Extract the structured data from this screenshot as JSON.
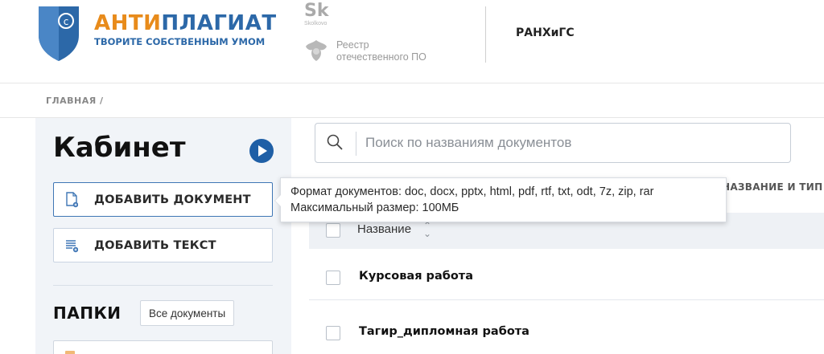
{
  "header": {
    "brand_part1": "АНТИ",
    "brand_part2": "ПЛАГИАТ",
    "tagline": "ТВОРИТЕ СОБСТВЕННЫМ УМОМ",
    "skolkovo_mark": "Sk",
    "skolkovo_small": "Skolkovo",
    "registry_line1": "Реестр",
    "registry_line2": "отечественного ПО",
    "org_name": "РАНХиГС"
  },
  "breadcrumb": {
    "home": "ГЛАВНАЯ /"
  },
  "sidebar": {
    "title": "Кабинет",
    "add_document": "ДОБАВИТЬ ДОКУМЕНТ",
    "add_text": "ДОБАВИТЬ ТЕКСТ",
    "folders_label": "ПАПКИ",
    "all_documents": "Все документы"
  },
  "search": {
    "placeholder": "Поиск по названиям документов",
    "value": ""
  },
  "sort": {
    "label": "НАЗВАНИЕ И ТИП"
  },
  "table": {
    "column_name": "Название",
    "rows": [
      {
        "title": "Курсовая работа"
      },
      {
        "title": "Тагир_дипломная работа"
      }
    ]
  },
  "tooltip": {
    "line1": "Формат документов: doc, docx, pptx, html, pdf, rtf, txt, odt, 7z, zip, rar",
    "line2": "Максимальный размер: 100МБ"
  },
  "colors": {
    "brand_orange": "#e88b1b",
    "brand_blue": "#2c68a8",
    "accent_blue": "#1f5fa6"
  }
}
